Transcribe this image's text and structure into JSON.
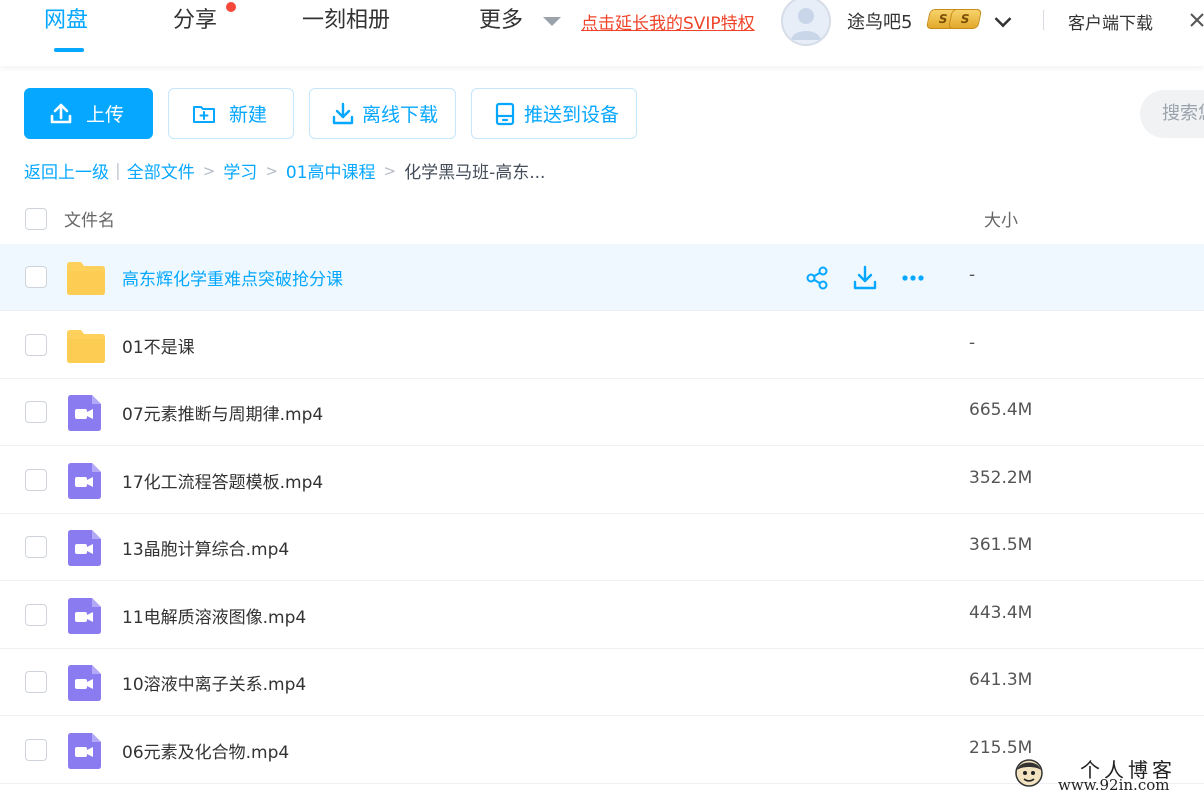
{
  "nav": {
    "tabs": [
      {
        "label": "网盘",
        "active": true
      },
      {
        "label": "分享",
        "has_badge": true
      },
      {
        "label": "一刻相册"
      },
      {
        "label": "更多"
      }
    ],
    "svip_link": "点击延长我的SVIP特权",
    "username": "途鸟吧5",
    "coin_label": "S",
    "client_download": "客户端下载"
  },
  "toolbar": {
    "upload": "上传",
    "new": "新建",
    "offline_download": "离线下载",
    "push_to_device": "推送到设备",
    "search_placeholder": "搜索您"
  },
  "breadcrumb": {
    "back": "返回上一级",
    "separator": "|",
    "items": [
      "全部文件",
      "学习",
      "01高中课程"
    ],
    "current": "化学黑马班-高东..."
  },
  "table": {
    "col_name": "文件名",
    "col_size": "大小",
    "rows": [
      {
        "name": "高东辉化学重难点突破抢分课",
        "size": "-",
        "type": "folder",
        "hover": true
      },
      {
        "name": "01不是课",
        "size": "-",
        "type": "folder"
      },
      {
        "name": "07元素推断与周期律.mp4",
        "size": "665.4M",
        "type": "video"
      },
      {
        "name": "17化工流程答题模板.mp4",
        "size": "352.2M",
        "type": "video"
      },
      {
        "name": "13晶胞计算综合.mp4",
        "size": "361.5M",
        "type": "video"
      },
      {
        "name": "11电解质溶液图像.mp4",
        "size": "443.4M",
        "type": "video"
      },
      {
        "name": "10溶液中离子关系.mp4",
        "size": "641.3M",
        "type": "video"
      },
      {
        "name": "06元素及化合物.mp4",
        "size": "215.5M",
        "type": "video"
      }
    ]
  },
  "watermark": {
    "title": "个人博客",
    "url": "www.92in.com"
  },
  "colors": {
    "accent": "#06a7ff",
    "svip": "#f0442a",
    "folder": "#ffd15c",
    "video": "#8a7bf0",
    "row_hover": "#eef8fe"
  }
}
